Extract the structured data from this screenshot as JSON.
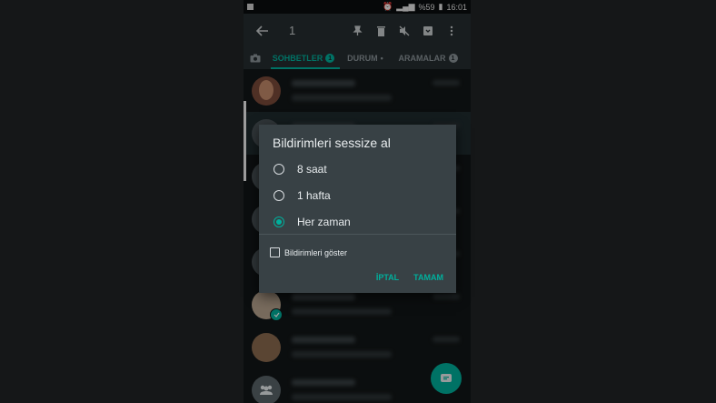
{
  "statusbar": {
    "battery": "%59",
    "time": "16:01"
  },
  "toolbar": {
    "selection_count": "1",
    "icons": [
      "back-arrow-icon",
      "pin-icon",
      "delete-icon",
      "mute-icon",
      "archive-icon",
      "more-icon"
    ]
  },
  "tabs": {
    "chats_label": "SOHBETLER",
    "chats_badge": "1",
    "status_label": "DURUM",
    "status_dot": "•",
    "calls_label": "ARAMALAR",
    "calls_badge": "1"
  },
  "dialog": {
    "title": "Bildirimleri sessize al",
    "options": [
      {
        "label": "8 saat",
        "selected": false
      },
      {
        "label": "1 hafta",
        "selected": false
      },
      {
        "label": "Her zaman",
        "selected": true
      }
    ],
    "checkbox_label": "Bildirimleri göster",
    "checkbox_checked": false,
    "cancel_label": "İPTAL",
    "ok_label": "TAMAM"
  },
  "colors": {
    "accent": "#00af9c",
    "toolbar": "#262d31",
    "dialog": "#384145",
    "background": "#121617"
  }
}
